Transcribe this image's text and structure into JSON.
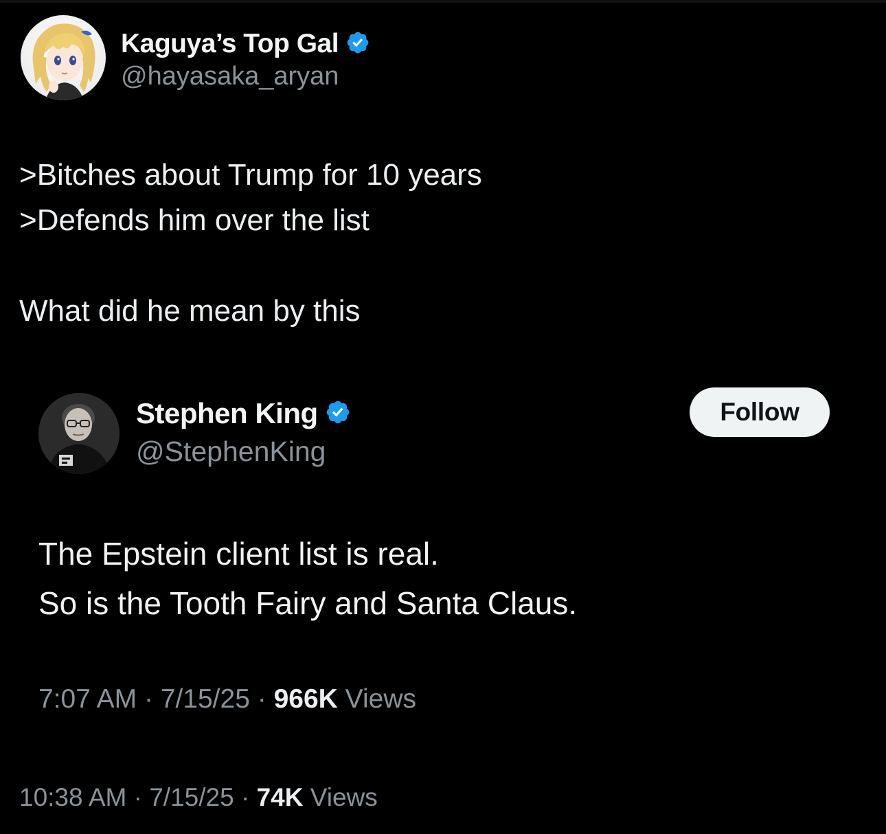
{
  "outer_tweet": {
    "author": {
      "name": "Kaguya’s Top Gal",
      "handle": "@hayasaka_aryan",
      "verified": true
    },
    "text_lines": [
      ">Bitches about Trump for 10 years",
      ">Defends him over the list",
      "",
      "What did he mean by this"
    ],
    "meta": {
      "time": "10:38 AM",
      "date": "7/15/25",
      "views_count": "74K",
      "views_label": "Views",
      "separator": "·"
    }
  },
  "quoted_tweet": {
    "author": {
      "name": "Stephen King",
      "handle": "@StephenKing",
      "verified": true
    },
    "follow_label": "Follow",
    "text_lines": [
      "The Epstein client list is real.",
      "So is the Tooth Fairy and Santa Claus."
    ],
    "meta": {
      "time": "7:07 AM",
      "date": "7/15/25",
      "views_count": "966K",
      "views_label": "Views",
      "separator": "·"
    }
  },
  "colors": {
    "background": "#000000",
    "primary_text": "#e7e9ea",
    "secondary_text": "#8b9299",
    "verified_blue": "#1d9bf0",
    "follow_button_bg": "#eff3f4"
  },
  "icons": [
    "verified-badge-icon"
  ]
}
